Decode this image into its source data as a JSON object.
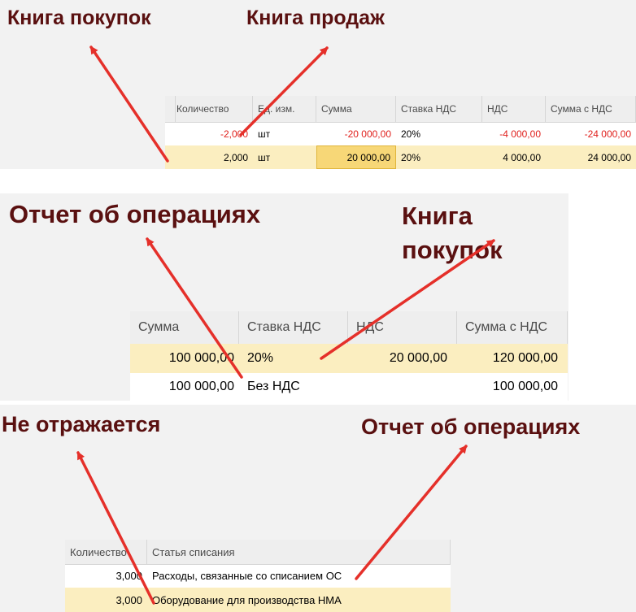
{
  "section1": {
    "label_left": "Книга покупок",
    "label_right": "Книга продаж",
    "columns": [
      "Количество",
      "Ед. изм.",
      "Сумма",
      "Ставка НДС",
      "НДС",
      "Сумма с НДС"
    ],
    "rows": [
      [
        "-2,000",
        "шт",
        "-20 000,00",
        "20%",
        "-4 000,00",
        "-24 000,00"
      ],
      [
        "2,000",
        "шт",
        "20 000,00",
        "20%",
        "4 000,00",
        "24 000,00"
      ]
    ]
  },
  "section2": {
    "label_left": "Отчет об операциях",
    "label_right_line1": "Книга",
    "label_right_line2": "покупок",
    "columns": [
      "Сумма",
      "Ставка НДС",
      "НДС",
      "Сумма с НДС"
    ],
    "rows": [
      [
        "100 000,00",
        "20%",
        "20 000,00",
        "120 000,00"
      ],
      [
        "100 000,00",
        "Без НДС",
        "",
        "100 000,00"
      ]
    ]
  },
  "section3": {
    "label_left": "Не отражается",
    "label_right": "Отчет об операциях",
    "columns": [
      "Количество",
      "Статья списания"
    ],
    "rows": [
      [
        "3,000",
        "Расходы, связанные со списанием ОС"
      ],
      [
        "3,000",
        "Оборудование для производства НМА"
      ]
    ]
  },
  "colors": {
    "label": "#5a1010",
    "arrow": "#e5302a",
    "negative": "#e0201c",
    "selected_row": "#fbeec0",
    "selected_cell": "#f7d777",
    "panel": "#f2f2f2"
  }
}
